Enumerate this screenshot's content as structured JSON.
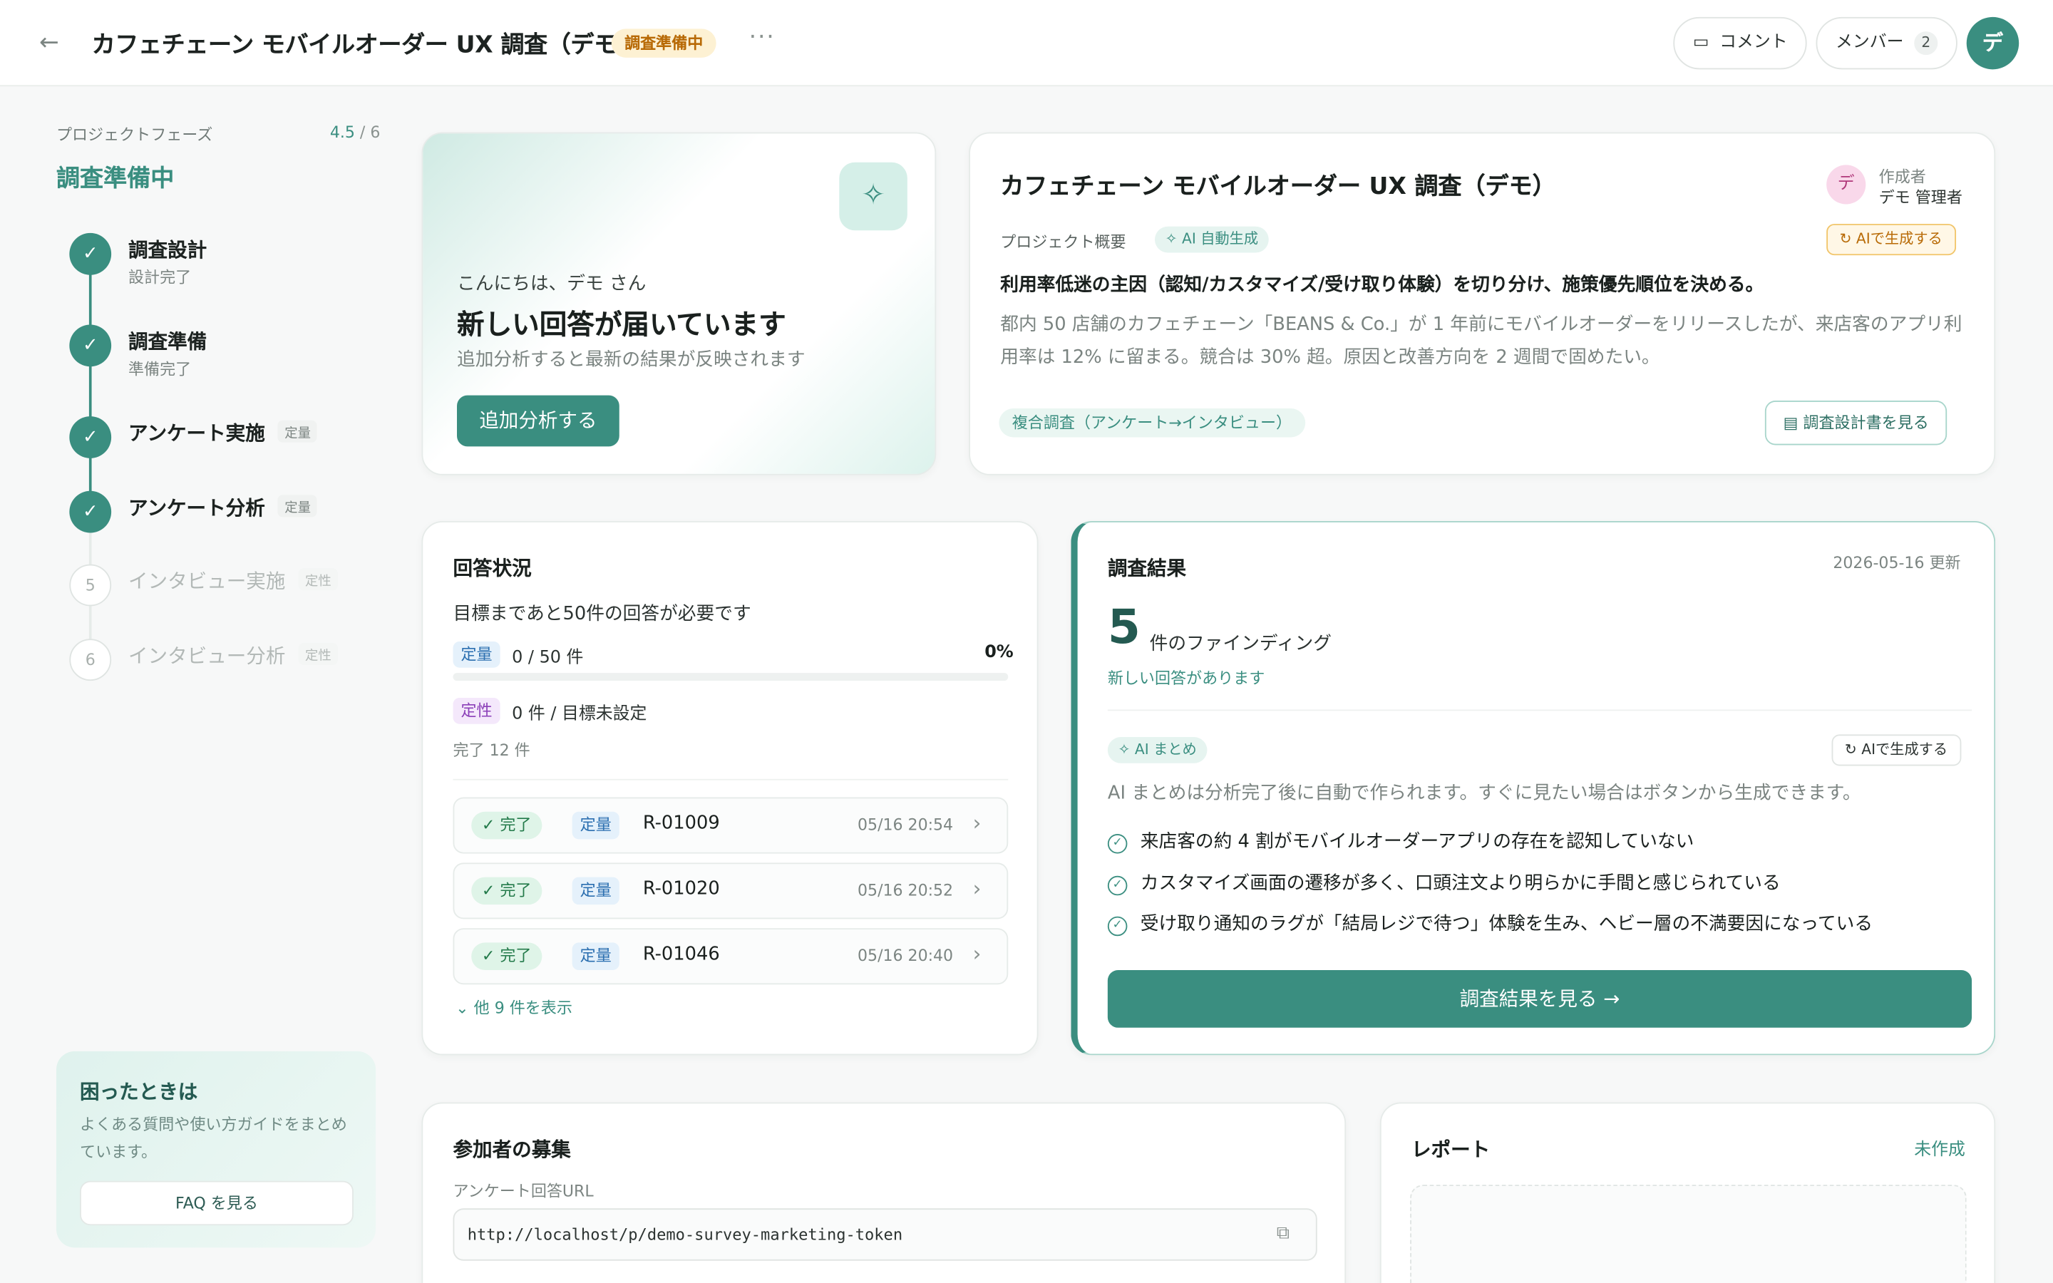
{
  "header": {
    "title": "カフェチェーン モバイルオーダー UX 調査（デモ）",
    "status": "調査準備中",
    "comment_label": "コメント",
    "members_label": "メンバー",
    "members_count": "2",
    "user_initial": "デ"
  },
  "sidebar": {
    "phase_label": "プロジェクトフェーズ",
    "progress_current": "4.5",
    "progress_total": " / 6",
    "current_phase": "調査準備中",
    "steps": [
      {
        "name": "調査設計",
        "sub": "設計完了",
        "tag": "",
        "done": true
      },
      {
        "name": "調査準備",
        "sub": "準備完了",
        "tag": "",
        "done": true
      },
      {
        "name": "アンケート実施",
        "sub": "",
        "tag": "定量",
        "done": true
      },
      {
        "name": "アンケート分析",
        "sub": "",
        "tag": "定量",
        "done": true
      },
      {
        "name": "インタビュー実施",
        "sub": "",
        "tag": "定性",
        "done": false,
        "number": "5"
      },
      {
        "name": "インタビュー分析",
        "sub": "",
        "tag": "定性",
        "done": false,
        "number": "6"
      }
    ],
    "help": {
      "title": "困ったときは",
      "desc": "よくある質問や使い方ガイドをまとめています。",
      "button": "FAQ を見る"
    }
  },
  "greeting": {
    "hello": "こんにちは、デモ さん",
    "headline": "新しい回答が届いています",
    "sub": "追加分析すると最新の結果が反映されます",
    "button": "追加分析する"
  },
  "overview": {
    "title": "カフェチェーン モバイルオーダー UX 調査（デモ）",
    "creator_label": "作成者",
    "creator_name": "デモ 管理者",
    "creator_initial": "デ",
    "section_label": "プロジェクト概要",
    "ai_badge": "AI 自動生成",
    "ai_generate": "AIで生成する",
    "goal": "利用率低迷の主因（認知/カスタマイズ/受け取り体験）を切り分け、施策優先順位を決める。",
    "description": "都内 50 店舗のカフェチェーン「BEANS & Co.」が 1 年前にモバイルオーダーをリリースしたが、来店客のアプリ利用率は 12% に留まる。競合は 30% 超。原因と改善方向を 2 週間で固めたい。",
    "method": "複合調査（アンケート→インタビュー）",
    "doc_button": "調査設計書を見る"
  },
  "responses": {
    "title": "回答状況",
    "subtitle": "目標まであと50件の回答が必要です",
    "quant_tag": "定量",
    "quant_count": "0 / 50 件",
    "quant_pct": "0%",
    "quant_progress": 0,
    "qual_tag": "定性",
    "qual_count": "0 件 / 目標未設定",
    "done_label": "完了 12 件",
    "rows": [
      {
        "status": "✓ 完了",
        "type": "定量",
        "id": "R-01009",
        "time": "05/16 20:54"
      },
      {
        "status": "✓ 完了",
        "type": "定量",
        "id": "R-01020",
        "time": "05/16 20:52"
      },
      {
        "status": "✓ 完了",
        "type": "定量",
        "id": "R-01046",
        "time": "05/16 20:40"
      }
    ],
    "more": "他 9 件を表示"
  },
  "results": {
    "title": "調査結果",
    "updated": "2026-05-16 更新",
    "count": "5",
    "count_label": "件のファインディング",
    "new_note": "新しい回答があります",
    "ai_badge": "AI まとめ",
    "ai_generate": "AIで生成する",
    "ai_note": "AI まとめは分析完了後に自動で作られます。すぐに見たい場合はボタンから生成できます。",
    "findings": [
      "来店客の約 4 割がモバイルオーダーアプリの存在を認知していない",
      "カスタマイズ画面の遷移が多く、口頭注文より明らかに手間と感じられている",
      "受け取り通知のラグが「結局レジで待つ」体験を生み、ヘビー層の不満要因になっている"
    ],
    "button": "調査結果を見る →"
  },
  "recruit": {
    "title": "参加者の募集",
    "url_label": "アンケート回答URL",
    "url": "http://localhost/p/demo-survey-marketing-token"
  },
  "report": {
    "title": "レポート",
    "status": "未作成"
  }
}
